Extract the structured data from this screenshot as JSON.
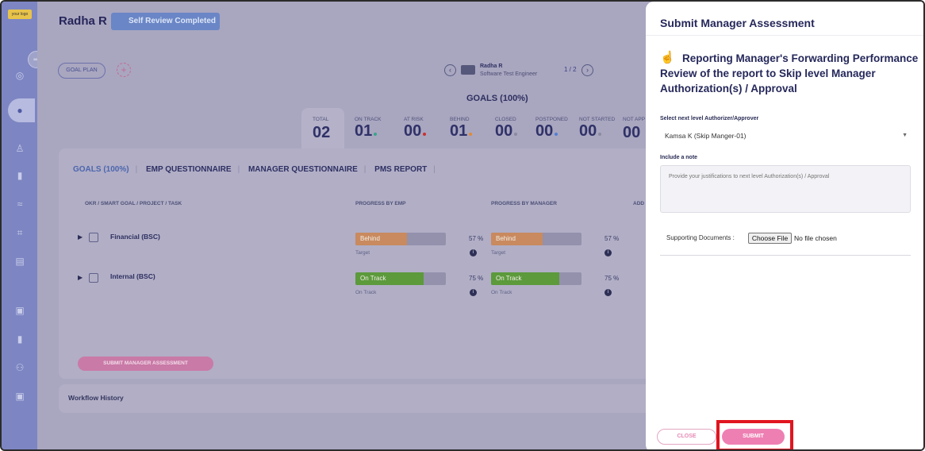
{
  "app": {
    "logo_text": "your logo"
  },
  "header": {
    "employee_name": "Radha R",
    "review_badge": "Self Review Completed",
    "goal_plan_label": "GOAL PLAN",
    "card_name": "Radha R",
    "card_role": "Software Test Engineer",
    "pager": "1 / 2"
  },
  "goals": {
    "title": "GOALS (100%)",
    "stats": [
      {
        "label": "TOTAL",
        "value": "02",
        "dot": ""
      },
      {
        "label": "ON TRACK",
        "value": "01",
        "dot": "#3aa58a"
      },
      {
        "label": "AT RISK",
        "value": "00",
        "dot": "#c8322d"
      },
      {
        "label": "BEHIND",
        "value": "01",
        "dot": "#e08a33"
      },
      {
        "label": "CLOSED",
        "value": "00",
        "dot": "#8a8aa0"
      },
      {
        "label": "POSTPONED",
        "value": "00",
        "dot": "#4f80d1"
      },
      {
        "label": "NOT STARTED",
        "value": "00",
        "dot": "#8a8aa0"
      },
      {
        "label": "NOT APP",
        "value": "00",
        "dot": ""
      }
    ]
  },
  "tabs": {
    "goals": "GOALS (100%)",
    "emp_questionnaire": "EMP QUESTIONNAIRE",
    "manager_questionnaire": "MANAGER QUESTIONNAIRE",
    "pms_report": "PMS REPORT"
  },
  "table": {
    "col_goal": "OKR / SMART GOAL / PROJECT / TASK",
    "col_emp": "PROGRESS BY EMP",
    "col_mgr": "PROGRESS BY MANAGER",
    "col_add": "ADD",
    "rows": [
      {
        "title": "Financial (BSC)",
        "status": "Behind",
        "progress": 57,
        "pct_label": "57 %",
        "sub": "Target",
        "color": "#c98a5f"
      },
      {
        "title": "Internal (BSC)",
        "status": "On Track",
        "progress": 75,
        "pct_label": "75 %",
        "sub": "On Track",
        "color": "#5c9a3c"
      }
    ]
  },
  "actions": {
    "submit_manager_assessment": "SUBMIT MANAGER ASSESSMENT"
  },
  "workflow": {
    "title": "Workflow History"
  },
  "drawer": {
    "title": "Submit Manager Assessment",
    "heading": "Reporting Manager's Forwarding Performance Review of the report to Skip level Manager Authorization(s) / Approval",
    "approver_label": "Select next level Authorizer/Approver",
    "approver_value": "Kamsa K (Skip Manger-01)",
    "note_label": "Include a note",
    "note_placeholder": "Provide your justifications to next level Authorization(s) / Approval",
    "support_label": "Supporting Documents :",
    "file_button": "Choose File",
    "file_status": "No file chosen",
    "close_label": "CLOSE",
    "submit_label": "SUBMIT"
  }
}
